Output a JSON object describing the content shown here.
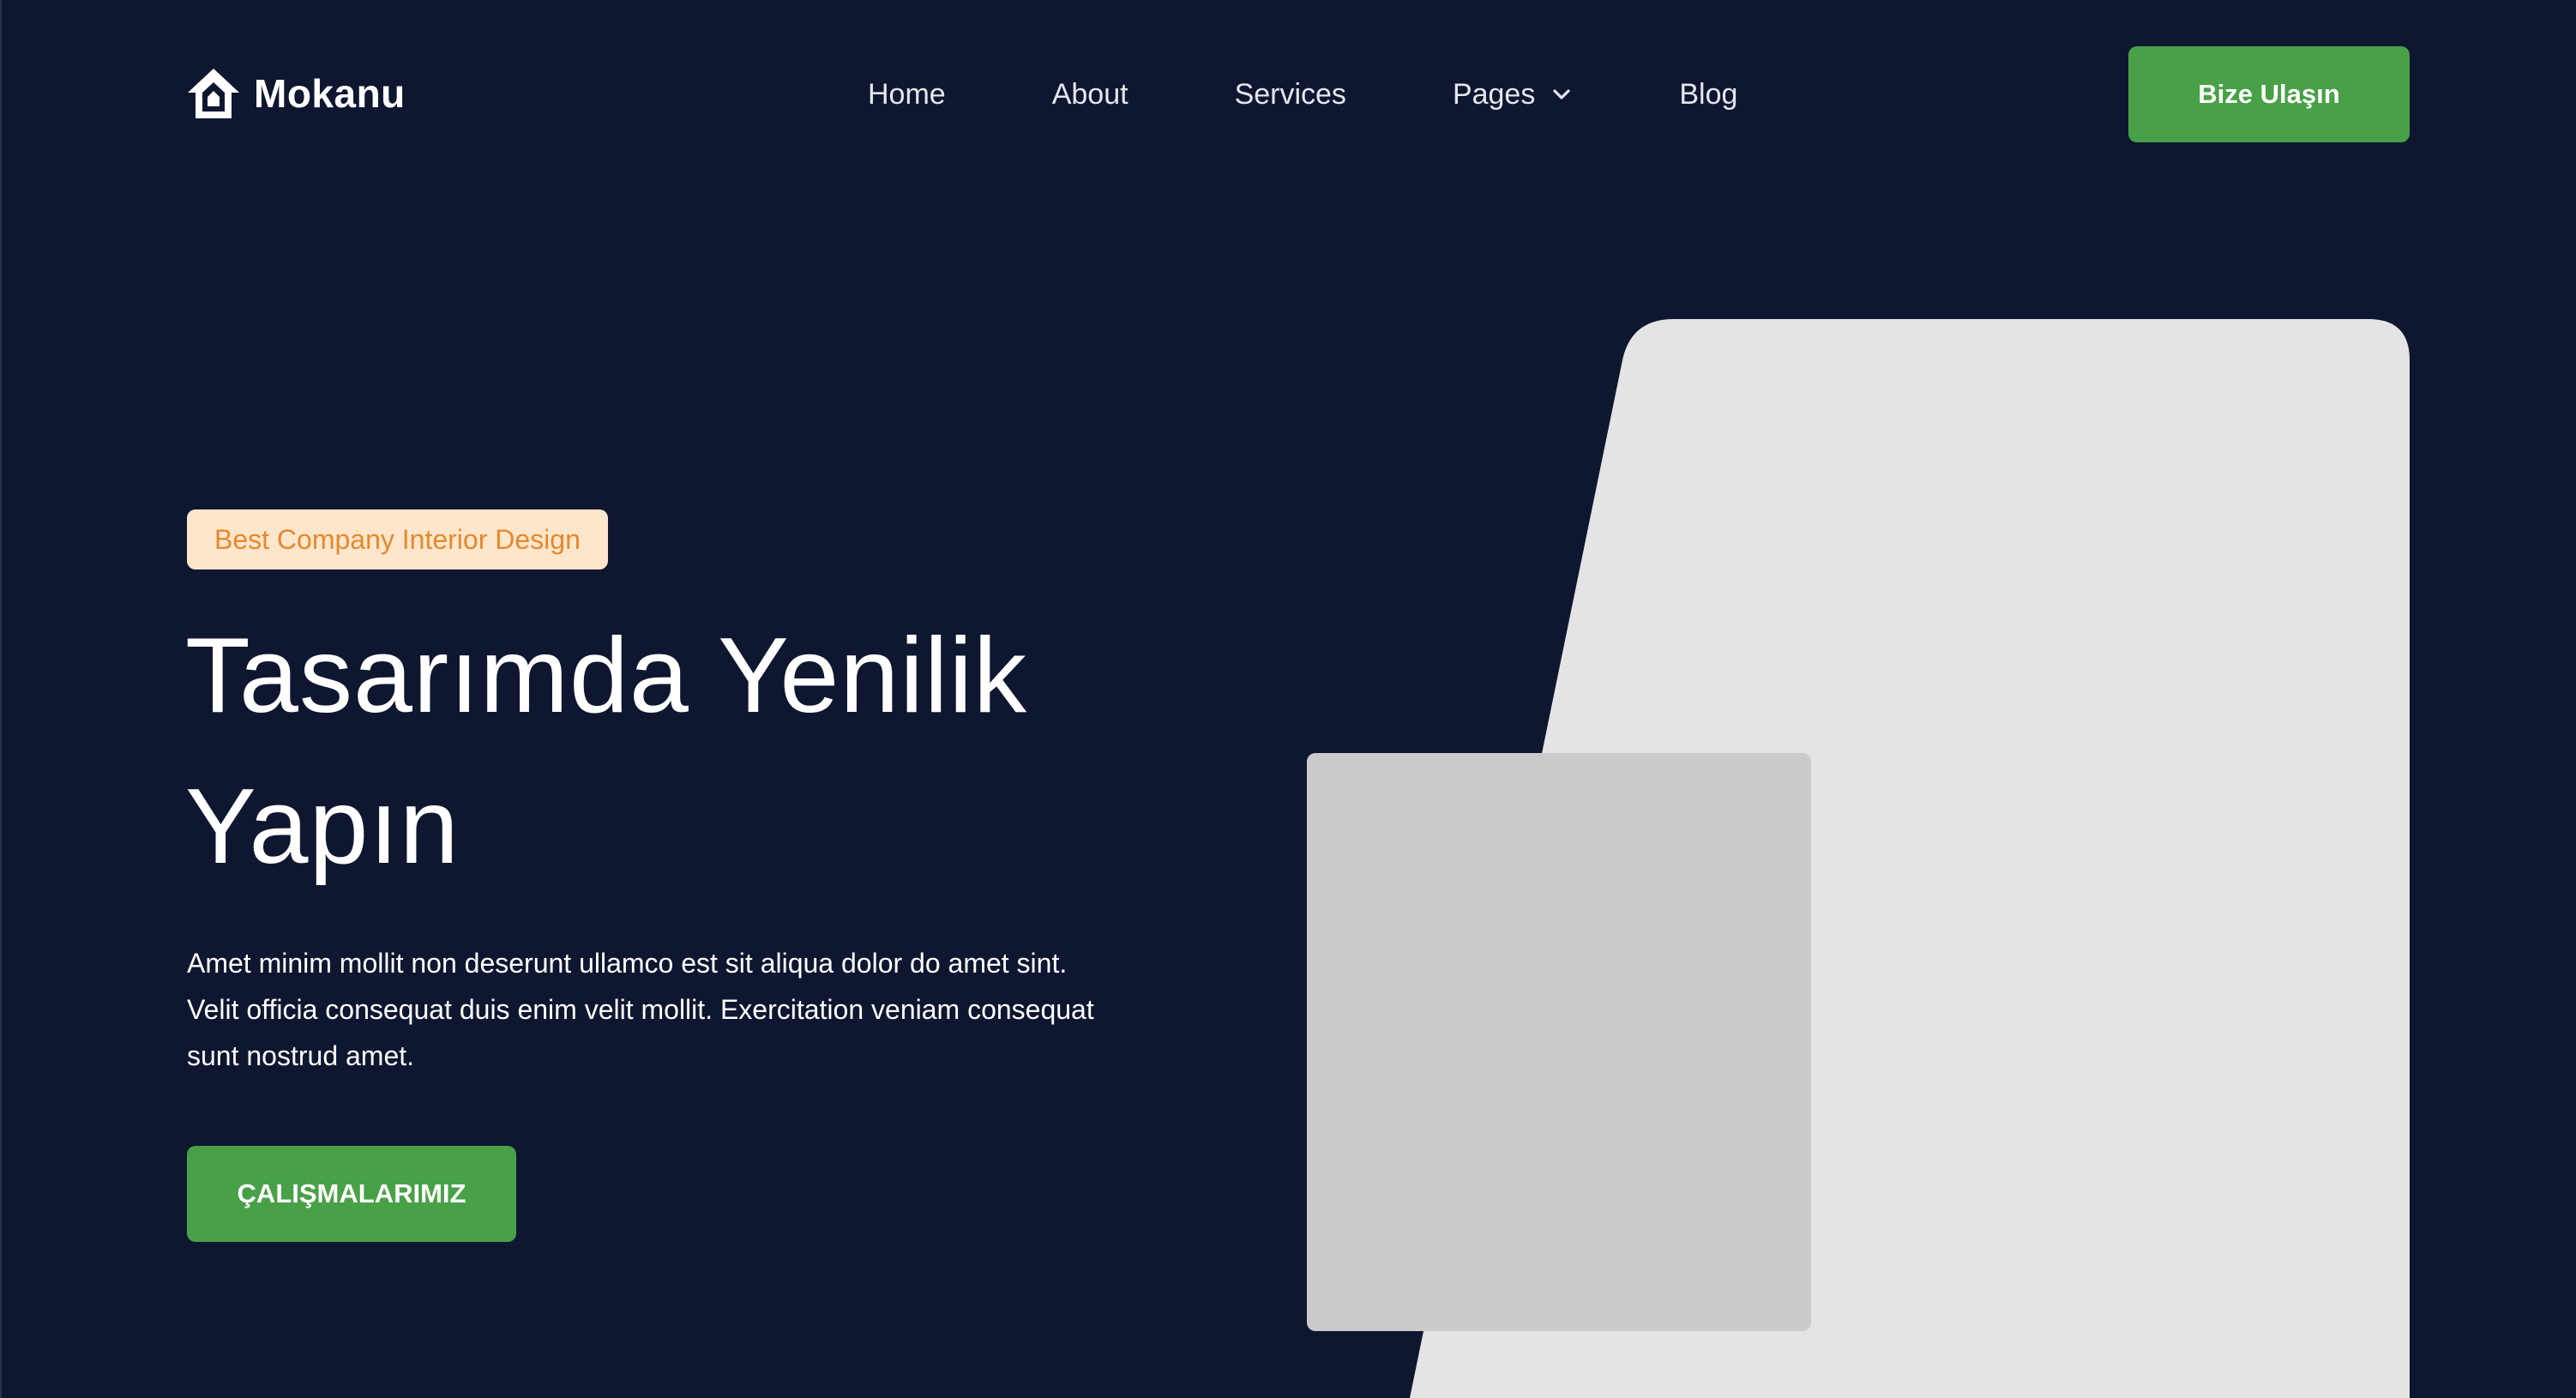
{
  "brand": {
    "name": "Mokanu",
    "logo_icon": "house-icon"
  },
  "nav": {
    "items": [
      {
        "label": "Home"
      },
      {
        "label": "About"
      },
      {
        "label": "Services"
      },
      {
        "label": "Pages",
        "icon": "chevron-down-icon"
      },
      {
        "label": "Blog"
      }
    ]
  },
  "header": {
    "cta_label": "Bize Ulaşın"
  },
  "hero": {
    "badge": "Best Company Interior Design",
    "title": "Tasarımda Yenilik Yapın",
    "description": "Amet minim mollit non deserunt ullamco est sit aliqua dolor do amet sint. Velit officia consequat duis enim velit mollit. Exercitation veniam consequat sunt nostrud amet.",
    "cta_label": "ÇALIŞMALARIMIZ"
  },
  "colors": {
    "background": "#0f1730",
    "accent_green": "#48a047",
    "badge_background": "#fde6cc",
    "badge_text": "#e6892d",
    "image_placeholder_light": "#e4e4e4",
    "image_placeholder_dark": "#cbcbcb"
  }
}
